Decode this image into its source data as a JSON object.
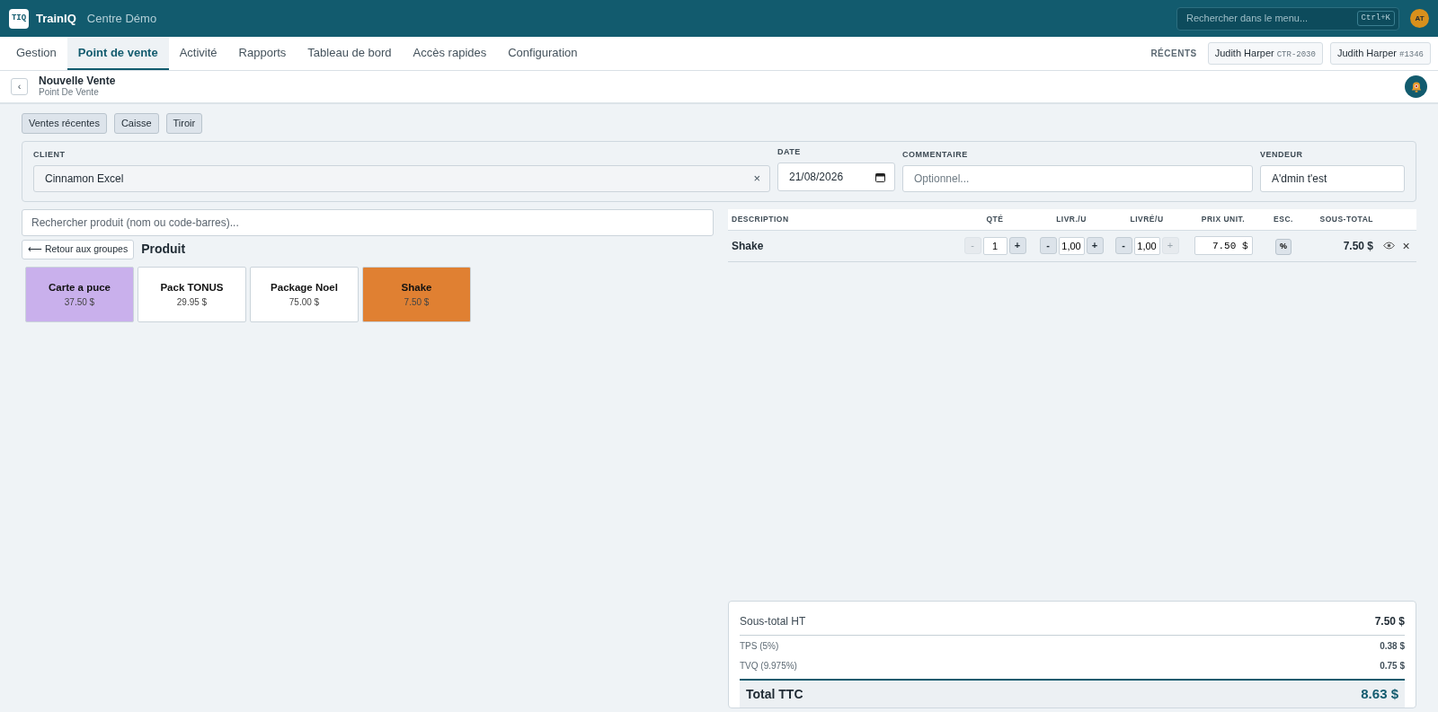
{
  "app": {
    "logo": "TIQ",
    "brand": "TrainIQ",
    "center": "Centre Démo",
    "menu_search": {
      "placeholder": "Rechercher dans le menu...",
      "shortcut": "Ctrl+K"
    },
    "avatar": "AT"
  },
  "tabs": [
    {
      "label": "Gestion",
      "selected": false
    },
    {
      "label": "Point de vente",
      "selected": true
    },
    {
      "label": "Activité",
      "selected": false
    },
    {
      "label": "Rapports",
      "selected": false
    },
    {
      "label": "Tableau de bord",
      "selected": false
    },
    {
      "label": "Accès rapides",
      "selected": false
    },
    {
      "label": "Configuration",
      "selected": false
    }
  ],
  "recents": {
    "label": "RÉCENTS",
    "items": [
      {
        "name": "Judith Harper",
        "code": "CTR-2030"
      },
      {
        "name": "Judith Harper",
        "code": "#1346"
      }
    ]
  },
  "page": {
    "back": "‹",
    "title": "Nouvelle Vente",
    "subtitle": "Point De Vente"
  },
  "actions": [
    "Ventes récentes",
    "Caisse",
    "Tiroir"
  ],
  "form": {
    "client": {
      "label": "CLIENT",
      "value": "Cinnamon Excel",
      "clear": "×"
    },
    "date": {
      "label": "DATE",
      "value": "21/08/2026"
    },
    "comment": {
      "label": "COMMENTAIRE",
      "placeholder": "Optionnel..."
    },
    "seller": {
      "label": "VENDEUR",
      "value": "A'dmin t'est"
    }
  },
  "product_search": {
    "placeholder": "Rechercher produit (nom ou code-barres)..."
  },
  "back_to_groups": "⟵ Retour aux groupes",
  "group_title": "Produit",
  "products": [
    {
      "name": "Carte a puce",
      "price": "37.50 $",
      "color": "#c9b0ec"
    },
    {
      "name": "Pack TONUS",
      "price": "29.95 $",
      "color": "#ffffff"
    },
    {
      "name": "Package Noel",
      "price": "75.00 $",
      "color": "#ffffff"
    },
    {
      "name": "Shake",
      "price": "7.50 $",
      "color": "#e08032"
    }
  ],
  "table": {
    "columns": [
      "DESCRIPTION",
      "QTÉ",
      "LIVR./U",
      "LIVRÉ/U",
      "PRIX UNIT.",
      "ESC.",
      "SOUS-TOTAL"
    ],
    "rows": [
      {
        "description": "Shake",
        "steppers": [
          {
            "minus": "-",
            "value": "1",
            "plus": "+",
            "minus_disabled": true,
            "plus_disabled": false
          },
          {
            "minus": "-",
            "value": "1,00",
            "plus": "+",
            "minus_disabled": false,
            "plus_disabled": false
          },
          {
            "minus": "-",
            "value": "1,00",
            "plus": "+",
            "minus_disabled": false,
            "plus_disabled": true
          }
        ],
        "unit_price": "7.50 $",
        "discount": "%",
        "subtotal": "7.50 $",
        "remove": "×"
      }
    ]
  },
  "totals": [
    {
      "kind": "subtotal",
      "label": "Sous-total HT",
      "value": "7.50 $"
    },
    {
      "kind": "tax",
      "label": "TPS (5%)",
      "value": "0.38 $"
    },
    {
      "kind": "tax",
      "label": "TVQ (9.975%)",
      "value": "0.75 $"
    },
    {
      "kind": "total",
      "label": "Total TTC",
      "value": "8.63 $"
    }
  ]
}
